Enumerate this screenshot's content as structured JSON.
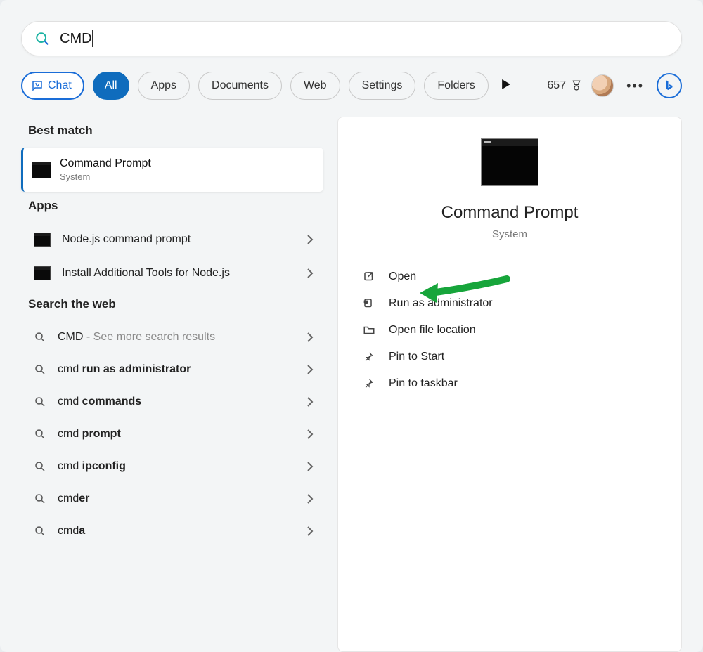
{
  "search": {
    "query": "CMD"
  },
  "filters": {
    "chat": "Chat",
    "all": "All",
    "tabs": [
      "Apps",
      "Documents",
      "Web",
      "Settings",
      "Folders"
    ]
  },
  "rewards": {
    "points": "657"
  },
  "left": {
    "best_match_label": "Best match",
    "best_match": {
      "title": "Command Prompt",
      "subtitle": "System"
    },
    "apps_label": "Apps",
    "apps": [
      {
        "label": "Node.js command prompt"
      },
      {
        "label": "Install Additional Tools for Node.js"
      }
    ],
    "web_label": "Search the web",
    "web": [
      {
        "prefix": "CMD",
        "suffix_muted": " - See more search results",
        "bold_suffix": ""
      },
      {
        "prefix": "cmd ",
        "bold_suffix": "run as administrator",
        "suffix_muted": ""
      },
      {
        "prefix": "cmd ",
        "bold_suffix": "commands",
        "suffix_muted": ""
      },
      {
        "prefix": "cmd ",
        "bold_suffix": "prompt",
        "suffix_muted": ""
      },
      {
        "prefix": "cmd ",
        "bold_suffix": "ipconfig",
        "suffix_muted": ""
      },
      {
        "prefix": "cmd",
        "bold_suffix": "er",
        "suffix_muted": ""
      },
      {
        "prefix": "cmd",
        "bold_suffix": "a",
        "suffix_muted": ""
      }
    ]
  },
  "right": {
    "title": "Command Prompt",
    "subtitle": "System",
    "actions": {
      "open": "Open",
      "run_admin": "Run as administrator",
      "open_loc": "Open file location",
      "pin_start": "Pin to Start",
      "pin_taskbar": "Pin to taskbar"
    }
  }
}
